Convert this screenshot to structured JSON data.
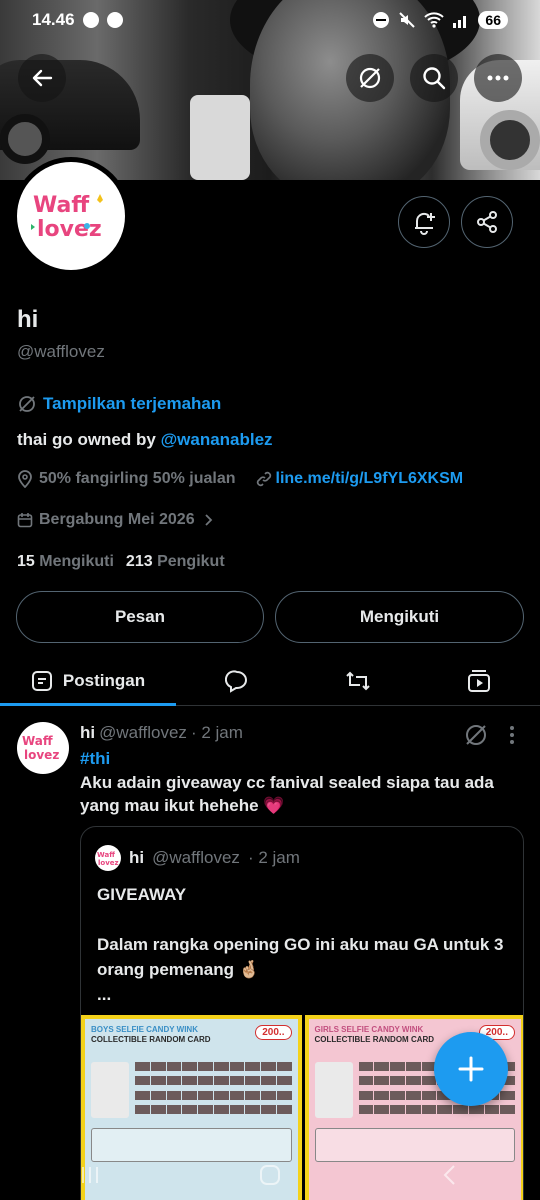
{
  "status_bar": {
    "time": "14.46",
    "battery": "66"
  },
  "profile": {
    "display_name": "hi",
    "handle": "@wafflovez",
    "avatar_logo_text": "Waff lovez",
    "translate_label": "Tampilkan terjemahan",
    "bio_prefix": "thai go owned by ",
    "bio_mention": "@wananablez",
    "location": "50% fangirling 50% jualan",
    "link": "line.me/ti/g/L9fYL6XKSM",
    "joined": "Bergabung Mei 2026",
    "following_count": "15",
    "following_label": "Mengikuti",
    "followers_count": "213",
    "followers_label": "Pengikut",
    "message_button": "Pesan",
    "following_button": "Mengikuti"
  },
  "tabs": {
    "posts": "Postingan"
  },
  "tweet": {
    "name": "hi",
    "handle": "@wafflovez",
    "time": "· 2 jam",
    "hashtag": "#thi",
    "text": "Aku adain giveaway cc fanival sealed siapa tau ada yang mau ikut hehehe 💗",
    "quote": {
      "name": "hi",
      "handle": "@wafflovez",
      "time": "· 2 jam",
      "body": "GIVEAWAY\n\nDalam rangka opening GO ini aku mau GA untuk 3 orang pemenang 🤞🏼\n..."
    },
    "images": [
      {
        "title": "BOYS SELFIE CANDY WINK",
        "subtitle": "COLLECTIBLE RANDOM CARD",
        "price": "200.."
      },
      {
        "title": "GIRLS SELFIE CANDY WINK",
        "subtitle": "COLLECTIBLE RANDOM CARD",
        "price": "200.."
      }
    ]
  },
  "colors": {
    "accent": "#1d9bf0",
    "muted": "#71767b",
    "border": "#2f3336"
  }
}
